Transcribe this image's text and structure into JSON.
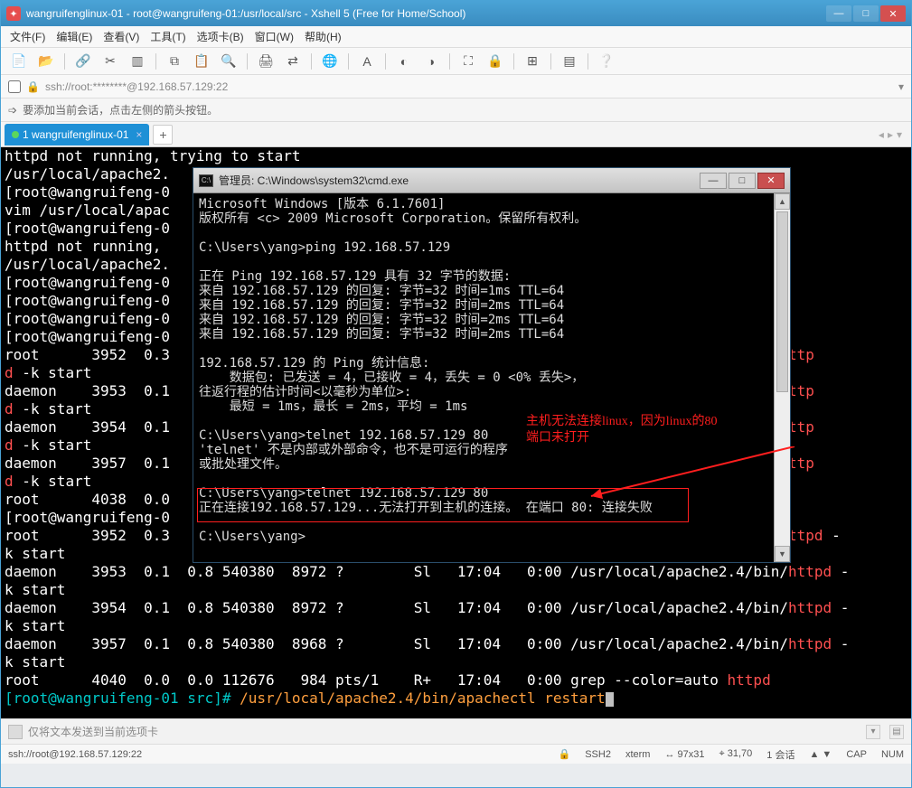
{
  "window": {
    "title": "wangruifenglinux-01 - root@wangruifeng-01:/usr/local/src - Xshell 5 (Free for Home/School)"
  },
  "menu": {
    "file": "文件(F)",
    "edit": "编辑(E)",
    "view": "查看(V)",
    "tool": "工具(T)",
    "tab": "选项卡(B)",
    "window": "窗口(W)",
    "help": "帮助(H)"
  },
  "address": "ssh://root:********@192.168.57.129:22",
  "hint": "要添加当前会话，点击左侧的箭头按钮。",
  "tab_label": "1 wangruifenglinux-01",
  "terminal_lines": [
    {
      "seg": [
        {
          "t": "httpd not running, trying to start"
        }
      ]
    },
    {
      "seg": [
        {
          "t": "/usr/local/apache2."
        }
      ]
    },
    {
      "seg": [
        {
          "t": "[root@wangruifeng-0"
        }
      ]
    },
    {
      "seg": [
        {
          "t": "vim /usr/local/apac"
        }
      ]
    },
    {
      "seg": [
        {
          "t": "[root@wangruifeng-0"
        }
      ]
    },
    {
      "seg": [
        {
          "t": "httpd not running, "
        }
      ]
    },
    {
      "seg": [
        {
          "t": "/usr/local/apache2."
        }
      ]
    },
    {
      "seg": [
        {
          "t": "[root@wangruifeng-0"
        }
      ]
    },
    {
      "seg": [
        {
          "t": "[root@wangruifeng-0"
        }
      ]
    },
    {
      "seg": [
        {
          "t": "[root@wangruifeng-0"
        }
      ]
    },
    {
      "seg": [
        {
          "t": "[root@wangruifeng-0"
        }
      ]
    },
    {
      "seg": [
        {
          "t": "root      3952  0.3                                                                   in/",
          "c": ""
        },
        {
          "t": "http",
          "c": "c-red2"
        }
      ]
    },
    {
      "seg": [
        {
          "t": "d",
          "c": "c-red2"
        },
        {
          "t": " -k start"
        }
      ]
    },
    {
      "seg": [
        {
          "t": "daemon    3953  0.1                                                                   in/"
        },
        {
          "t": "http",
          "c": "c-red2"
        }
      ]
    },
    {
      "seg": [
        {
          "t": "d",
          "c": "c-red2"
        },
        {
          "t": " -k start"
        }
      ]
    },
    {
      "seg": [
        {
          "t": "daemon    3954  0.1                                                                   in/"
        },
        {
          "t": "http",
          "c": "c-red2"
        }
      ]
    },
    {
      "seg": [
        {
          "t": "d",
          "c": "c-red2"
        },
        {
          "t": " -k start"
        }
      ]
    },
    {
      "seg": [
        {
          "t": "daemon    3957  0.1                                                                   in/"
        },
        {
          "t": "http",
          "c": "c-red2"
        }
      ]
    },
    {
      "seg": [
        {
          "t": "d",
          "c": "c-red2"
        },
        {
          "t": " -k start"
        }
      ]
    },
    {
      "seg": [
        {
          "t": "root      4038  0.0                                                                   "
        },
        {
          "t": "pd",
          "c": "c-red2"
        }
      ]
    },
    {
      "seg": [
        {
          "t": "[root@wangruifeng-0"
        }
      ]
    },
    {
      "seg": [
        {
          "t": "root      3952  0.3                                                                   in/"
        },
        {
          "t": "httpd",
          "c": "c-red2"
        },
        {
          "t": " -"
        }
      ]
    },
    {
      "seg": [
        {
          "t": "k start"
        }
      ]
    },
    {
      "seg": [
        {
          "t": "daemon    3953  0.1  0.8 540380  8972 ?        Sl   17:04   0:00 /usr/local/apache2.4/bin/"
        },
        {
          "t": "httpd",
          "c": "c-red2"
        },
        {
          "t": " -"
        }
      ]
    },
    {
      "seg": [
        {
          "t": "k start"
        }
      ]
    },
    {
      "seg": [
        {
          "t": "daemon    3954  0.1  0.8 540380  8972 ?        Sl   17:04   0:00 /usr/local/apache2.4/bin/"
        },
        {
          "t": "httpd",
          "c": "c-red2"
        },
        {
          "t": " -"
        }
      ]
    },
    {
      "seg": [
        {
          "t": "k start"
        }
      ]
    },
    {
      "seg": [
        {
          "t": "daemon    3957  0.1  0.8 540380  8968 ?        Sl   17:04   0:00 /usr/local/apache2.4/bin/"
        },
        {
          "t": "httpd",
          "c": "c-red2"
        },
        {
          "t": " -"
        }
      ]
    },
    {
      "seg": [
        {
          "t": "k start"
        }
      ]
    },
    {
      "seg": [
        {
          "t": "root      4040  0.0  0.0 112676   984 pts/1    R+   17:04   0:00 grep --color=auto "
        },
        {
          "t": "httpd",
          "c": "c-red2"
        }
      ]
    },
    {
      "seg": [
        {
          "t": "[root@wangruifeng-01 src]# ",
          "c": "c-cyan"
        },
        {
          "t": "/usr/local/apache2.4/bin/apachectl restart",
          "c": "c-orange"
        },
        {
          "t": "▮",
          "cur": true
        }
      ]
    }
  ],
  "cmd": {
    "title": "管理员: C:\\Windows\\system32\\cmd.exe",
    "lines": [
      "Microsoft Windows [版本 6.1.7601]",
      "版权所有 <c> 2009 Microsoft Corporation。保留所有权利。",
      "",
      "C:\\Users\\yang>ping 192.168.57.129",
      "",
      "正在 Ping 192.168.57.129 具有 32 字节的数据:",
      "来自 192.168.57.129 的回复: 字节=32 时间=1ms TTL=64",
      "来自 192.168.57.129 的回复: 字节=32 时间=2ms TTL=64",
      "来自 192.168.57.129 的回复: 字节=32 时间=2ms TTL=64",
      "来自 192.168.57.129 的回复: 字节=32 时间=2ms TTL=64",
      "",
      "192.168.57.129 的 Ping 统计信息:",
      "    数据包: 已发送 = 4，已接收 = 4，丢失 = 0 <0% 丢失>，",
      "往返行程的估计时间<以毫秒为单位>:",
      "    最短 = 1ms，最长 = 2ms，平均 = 1ms",
      "",
      "C:\\Users\\yang>telnet 192.168.57.129 80",
      "'telnet' 不是内部或外部命令，也不是可运行的程序",
      "或批处理文件。",
      "",
      "C:\\Users\\yang>telnet 192.168.57.129 80",
      "正在连接192.168.57.129...无法打开到主机的连接。 在端口 80: 连接失败",
      "",
      "C:\\Users\\yang>"
    ]
  },
  "annotation": {
    "line1": "主机无法连接linux，因为linux的80",
    "line2": "端口未打开"
  },
  "sendbar": "仅将文本发送到当前选项卡",
  "status": {
    "conn": "ssh://root@192.168.57.129:22",
    "proto": "SSH2",
    "term": "xterm",
    "size": "97x31",
    "pos": "31,70",
    "sess": "1 会话",
    "cap": "CAP",
    "num": "NUM"
  }
}
